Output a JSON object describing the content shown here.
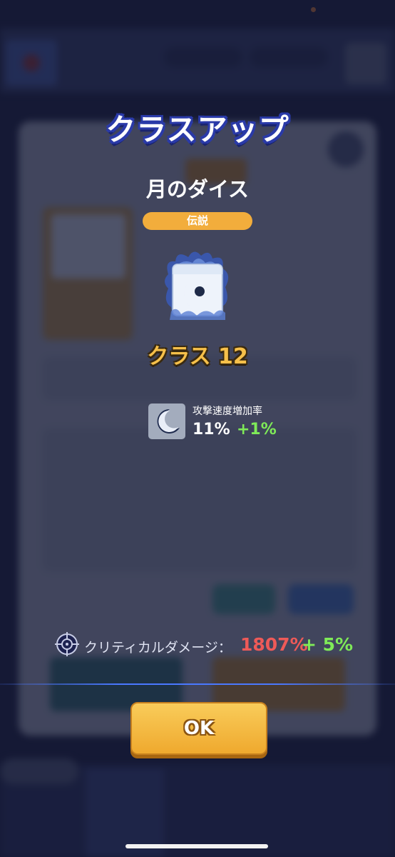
{
  "modal": {
    "title": "クラスアップ",
    "dice_name": "月のダイス",
    "rarity": "伝説",
    "dice_icon": "moon-dice-icon",
    "class_label": "クラス 12"
  },
  "stat": {
    "name": "攻撃速度増加率",
    "value": "11%",
    "bonus": "+1%",
    "icon": "crescent-moon-icon"
  },
  "crit": {
    "label": "クリティカルダメージ：",
    "value": "1807%",
    "bonus": "+ 5%",
    "icon": "crosshair-icon"
  },
  "ok_button": {
    "label": "OK"
  },
  "colors": {
    "title_outline": "#2a3aa8",
    "rarity_badge": "#f2ad3c",
    "class_text": "#f6c04a",
    "bonus_green": "#7fea58",
    "crit_red": "#ee5a58",
    "ok_button": "#f5b945"
  }
}
